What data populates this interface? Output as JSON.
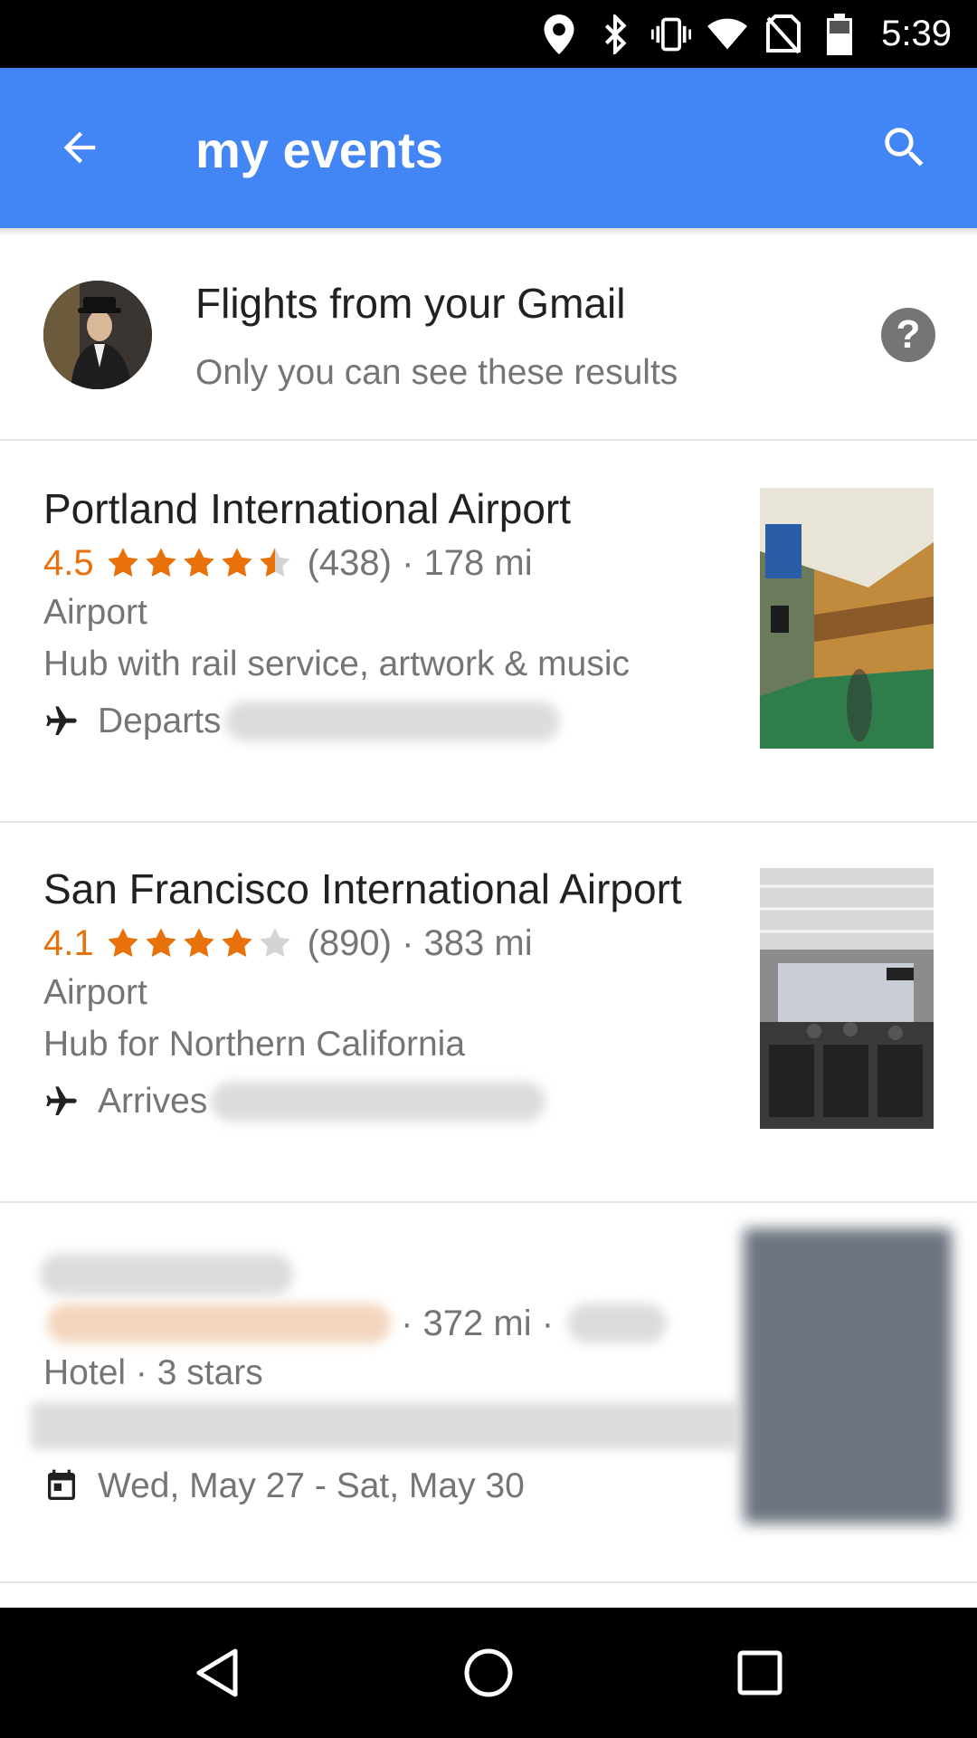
{
  "status_bar": {
    "time": "5:39",
    "icons": [
      "location-icon",
      "bluetooth-icon",
      "vibrate-icon",
      "wifi-icon",
      "no-sim-icon",
      "battery-icon"
    ]
  },
  "app_bar": {
    "title": "my events",
    "color": "#4285f4",
    "icons": [
      "back-arrow-icon",
      "search-icon"
    ]
  },
  "gmail_header": {
    "title": "Flights from your Gmail",
    "subtitle": "Only you can see these results",
    "help_label": "?"
  },
  "events": [
    {
      "name": "Portland International Airport",
      "rating": "4.5",
      "stars": 4.5,
      "reviews": "(438)",
      "distance": "178 mi",
      "type": "Airport",
      "description": "Hub with rail service, artwork & music",
      "event_icon": "airplane-icon",
      "event_label": "Departs"
    },
    {
      "name": "San Francisco International Airport",
      "rating": "4.1",
      "stars": 4.1,
      "reviews": "(890)",
      "distance": "383 mi",
      "type": "Airport",
      "description": "Hub for Northern California",
      "event_icon": "airplane-icon",
      "event_label": "Arrives"
    },
    {
      "distance": "372 mi",
      "type": "Hotel · 3 stars",
      "event_icon": "calendar-icon",
      "event_label": "Wed, May 27 - Sat, May 30"
    }
  ],
  "colors": {
    "accent": "#4285f4",
    "rating": "#e8710a",
    "secondary_text": "#757575"
  },
  "nav_bar": {
    "icons": [
      "back-triangle-icon",
      "home-circle-icon",
      "recents-square-icon"
    ]
  }
}
